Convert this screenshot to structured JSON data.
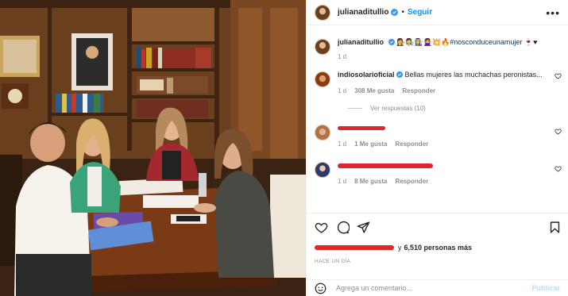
{
  "photo": {
    "alt": ""
  },
  "header": {
    "username": "julianaditullio",
    "separator": "•",
    "follow_label": "Seguir",
    "more_icon": "more-horizontal-icon"
  },
  "caption": {
    "username": "julianaditullio",
    "emojis": "👩‍⚖️👩‍🔬👩‍🏭🙅‍♀️💥🔥",
    "hashtag": "#nosconduceunamujer",
    "trailing_emojis": "🍷♥",
    "time": "1 d"
  },
  "comments": [
    {
      "username": "indiosolarioficial",
      "text": "Bellas mujeres las muchachas peronistas...",
      "time": "1 d",
      "likes": "308 Me gusta",
      "reply_label": "Responder",
      "view_replies": "Ver respuestas (10)"
    },
    {
      "username": "",
      "text": "",
      "time": "1 d",
      "likes": "1 Me gusta",
      "reply_label": "Responder"
    },
    {
      "username": "",
      "text": "",
      "time": "1 d",
      "likes": "8 Me gusta",
      "reply_label": "Responder"
    }
  ],
  "likes_summary": {
    "others": "6,510 personas más",
    "connector": "y"
  },
  "time_ago": "HACE UN DÍA",
  "composer": {
    "placeholder": "Agrega un comentario...",
    "post_label": "Publicar"
  },
  "colors": {
    "accent": "#0095f6",
    "redaction": "#e0262b",
    "muted": "#8e8e8e"
  }
}
